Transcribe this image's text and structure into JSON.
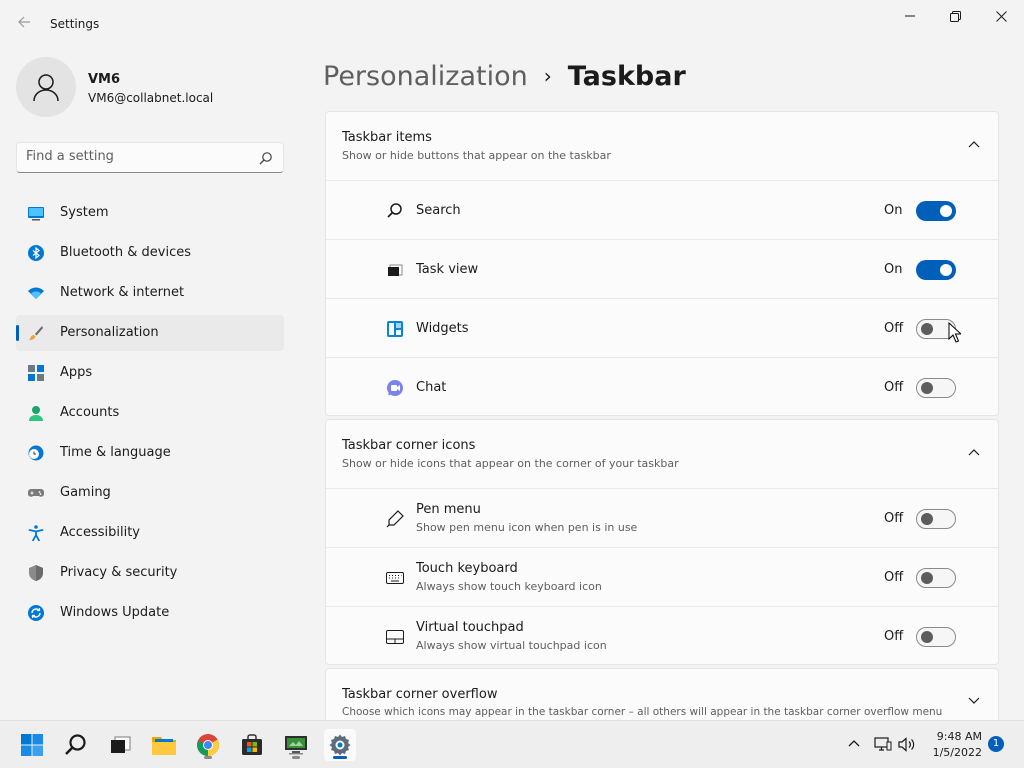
{
  "window": {
    "title": "Settings"
  },
  "profile": {
    "name": "VM6",
    "email": "VM6@collabnet.local"
  },
  "search": {
    "placeholder": "Find a setting"
  },
  "nav": [
    {
      "label": "System",
      "icon": "monitor-icon"
    },
    {
      "label": "Bluetooth & devices",
      "icon": "bluetooth-icon"
    },
    {
      "label": "Network & internet",
      "icon": "wifi-icon"
    },
    {
      "label": "Personalization",
      "icon": "brush-icon",
      "active": true
    },
    {
      "label": "Apps",
      "icon": "apps-icon"
    },
    {
      "label": "Accounts",
      "icon": "person-icon"
    },
    {
      "label": "Time & language",
      "icon": "clock-globe-icon"
    },
    {
      "label": "Gaming",
      "icon": "gamepad-icon"
    },
    {
      "label": "Accessibility",
      "icon": "accessibility-icon"
    },
    {
      "label": "Privacy & security",
      "icon": "shield-icon"
    },
    {
      "label": "Windows Update",
      "icon": "update-icon"
    }
  ],
  "breadcrumb": {
    "parent": "Personalization",
    "separator": "›",
    "current": "Taskbar"
  },
  "taskbar_items": {
    "title": "Taskbar items",
    "subtitle": "Show or hide buttons that appear on the taskbar",
    "rows": [
      {
        "label": "Search",
        "state": "On",
        "on": true,
        "icon": "search-icon"
      },
      {
        "label": "Task view",
        "state": "On",
        "on": true,
        "icon": "task-view-icon"
      },
      {
        "label": "Widgets",
        "state": "Off",
        "on": false,
        "icon": "widgets-icon"
      },
      {
        "label": "Chat",
        "state": "Off",
        "on": false,
        "icon": "chat-icon"
      }
    ]
  },
  "corner_icons": {
    "title": "Taskbar corner icons",
    "subtitle": "Show or hide icons that appear on the corner of your taskbar",
    "rows": [
      {
        "label": "Pen menu",
        "sub": "Show pen menu icon when pen is in use",
        "state": "Off",
        "on": false,
        "icon": "pen-icon"
      },
      {
        "label": "Touch keyboard",
        "sub": "Always show touch keyboard icon",
        "state": "Off",
        "on": false,
        "icon": "keyboard-icon"
      },
      {
        "label": "Virtual touchpad",
        "sub": "Always show virtual touchpad icon",
        "state": "Off",
        "on": false,
        "icon": "touchpad-icon"
      }
    ]
  },
  "corner_overflow": {
    "title": "Taskbar corner overflow",
    "subtitle": "Choose which icons may appear in the taskbar corner – all others will appear in the taskbar corner overflow menu"
  },
  "taskbar": {
    "time": "9:48 AM",
    "date": "1/5/2022",
    "notification_count": "1",
    "apps": [
      "start-icon",
      "search-icon",
      "task-view-icon",
      "file-explorer-icon",
      "chrome-icon",
      "store-icon",
      "remote-desktop-icon",
      "settings-icon"
    ]
  },
  "colors": {
    "accent": "#005fb8",
    "background": "#f3f3f3",
    "card": "#fbfbfb"
  }
}
